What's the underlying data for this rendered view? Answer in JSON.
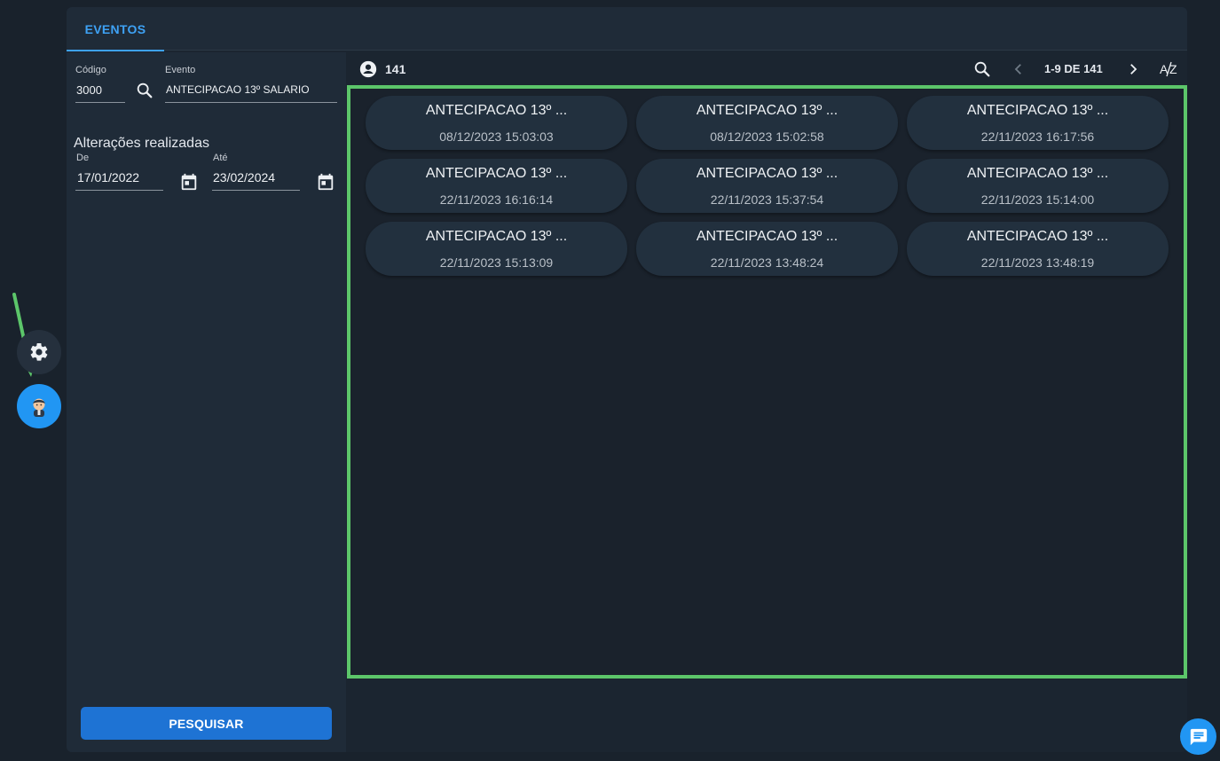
{
  "tabs": [
    {
      "label": "EVENTOS"
    }
  ],
  "filters": {
    "codigo_label": "Código",
    "codigo_value": "3000",
    "evento_label": "Evento",
    "evento_value": "ANTECIPACAO 13º SALARIO",
    "section_title": "Alterações realizadas",
    "de_label": "De",
    "de_value": "17/01/2022",
    "ate_label": "Até",
    "ate_value": "23/02/2024",
    "search_button": "PESQUISAR"
  },
  "toolbar": {
    "count": "141",
    "pagination": "1-9 DE 141"
  },
  "cards": [
    {
      "title": "ANTECIPACAO 13º ...",
      "date": "08/12/2023 15:03:03"
    },
    {
      "title": "ANTECIPACAO 13º ...",
      "date": "08/12/2023 15:02:58"
    },
    {
      "title": "ANTECIPACAO 13º ...",
      "date": "22/11/2023 16:17:56"
    },
    {
      "title": "ANTECIPACAO 13º ...",
      "date": "22/11/2023 16:16:14"
    },
    {
      "title": "ANTECIPACAO 13º ...",
      "date": "22/11/2023 15:37:54"
    },
    {
      "title": "ANTECIPACAO 13º ...",
      "date": "22/11/2023 15:14:00"
    },
    {
      "title": "ANTECIPACAO 13º ...",
      "date": "22/11/2023 15:13:09"
    },
    {
      "title": "ANTECIPACAO 13º ...",
      "date": "22/11/2023 13:48:24"
    },
    {
      "title": "ANTECIPACAO 13º ...",
      "date": "22/11/2023 13:48:19"
    }
  ],
  "icons": {
    "settings": "gear-icon",
    "avatar": "user-avatar-icon",
    "search": "search-icon",
    "calendar": "calendar-icon",
    "account": "account-circle-icon",
    "prev": "chevron-left-icon",
    "next": "chevron-right-icon",
    "sort": "sort-az-icon",
    "chat": "chat-icon"
  },
  "colors": {
    "accent": "#3ea2f5",
    "primary_button": "#1e73d4",
    "highlight_frame": "#5cc66a"
  }
}
